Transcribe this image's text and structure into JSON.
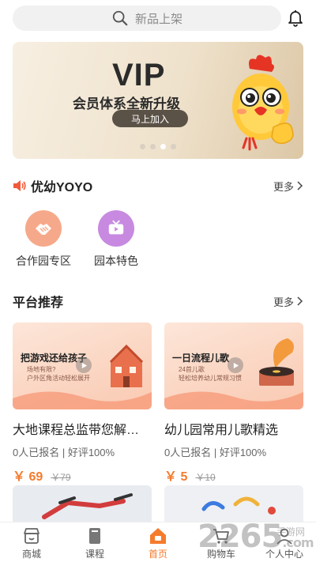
{
  "search": {
    "placeholder": "新品上架"
  },
  "banner": {
    "title": "VIP",
    "subtitle": "会员体系全新升级",
    "cta": "马上加入",
    "slides": 4,
    "active_slide": 3
  },
  "youyo": {
    "title": "优幼YOYO",
    "more": "更多"
  },
  "quick_links": [
    {
      "label": "合作园专区",
      "icon": "handshake-icon",
      "color": "#f6a98a"
    },
    {
      "label": "园本特色",
      "icon": "tv-icon",
      "color": "#c78ae0"
    }
  ],
  "recommend": {
    "title": "平台推荐",
    "more": "更多",
    "cards": [
      {
        "thumb_title": "把游戏还给孩子",
        "thumb_sub1": "场地有限?",
        "thumb_sub2": "户外区角活动轻松展开",
        "name": "大地课程总监带您解…",
        "meta": "0人已报名 | 好评100%",
        "price": "￥ 69",
        "old_price": "￥79"
      },
      {
        "thumb_title": "一日流程儿歌",
        "thumb_sub1": "24首儿歌",
        "thumb_sub2": "轻松培养幼儿常规习惯",
        "name": "幼儿园常用儿歌精选",
        "meta": "0人已报名 | 好评100%",
        "price": "￥ 5",
        "old_price": "￥10"
      }
    ]
  },
  "tabbar": [
    {
      "label": "商城",
      "icon": "shop-icon",
      "active": false
    },
    {
      "label": "课程",
      "icon": "book-icon",
      "active": false
    },
    {
      "label": "首页",
      "icon": "home-icon",
      "active": true
    },
    {
      "label": "购物车",
      "icon": "cart-icon",
      "active": false
    },
    {
      "label": "个人中心",
      "icon": "user-icon",
      "active": false
    }
  ],
  "watermark": {
    "text": "2265",
    "suffix": ".com",
    "sub": "手游网"
  },
  "colors": {
    "accent": "#f57b2d",
    "text": "#222222"
  }
}
